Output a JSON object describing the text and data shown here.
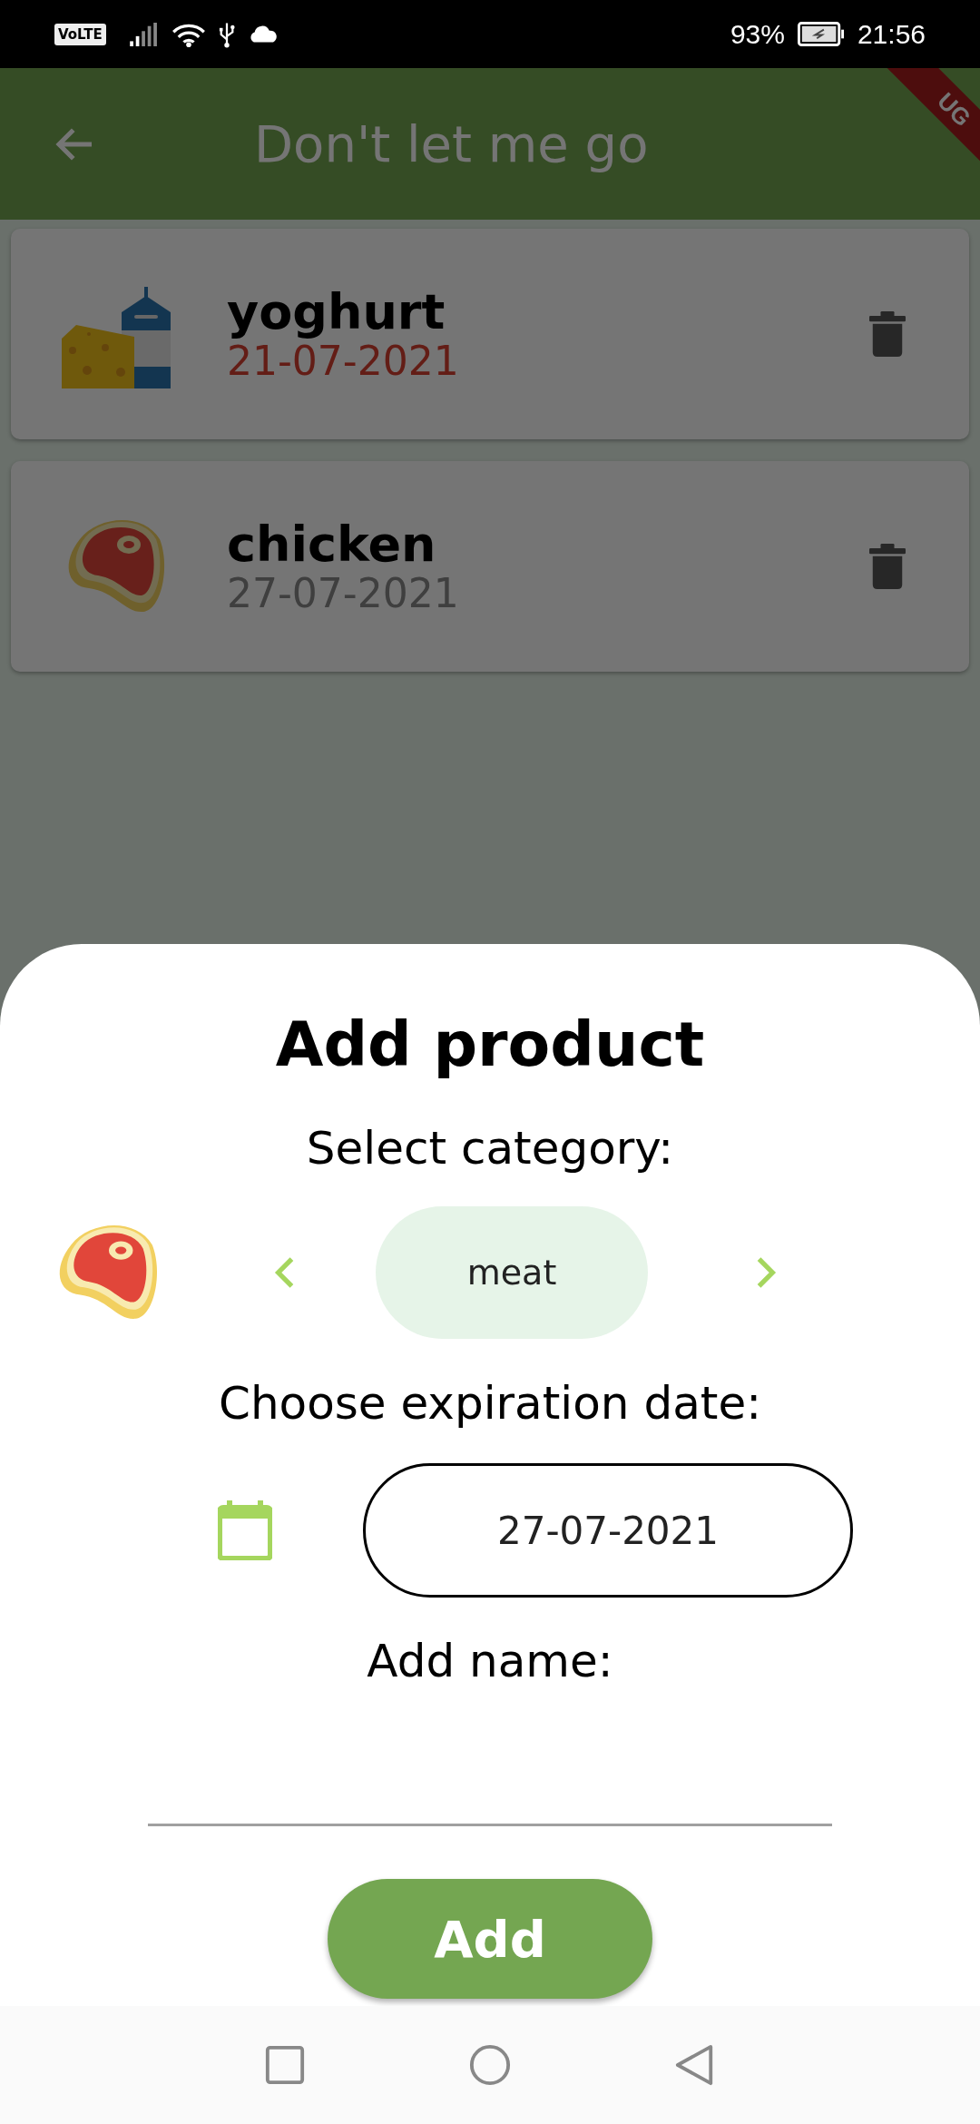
{
  "status_bar": {
    "network": "VoLTE",
    "battery": "93%",
    "time": "21:56"
  },
  "app_bar": {
    "title": "Don't let me go",
    "debug_banner": "UG"
  },
  "products": [
    {
      "name": "yoghurt",
      "date": "21-07-2021",
      "expired": true,
      "kind": "dairy"
    },
    {
      "name": "chicken",
      "date": "27-07-2021",
      "expired": false,
      "kind": "meat"
    }
  ],
  "sheet": {
    "title": "Add product",
    "category_label": "Select category:",
    "category": "meat",
    "date_label": "Choose expiration date:",
    "date": "27-07-2021",
    "name_label": "Add name:",
    "button": "Add"
  }
}
